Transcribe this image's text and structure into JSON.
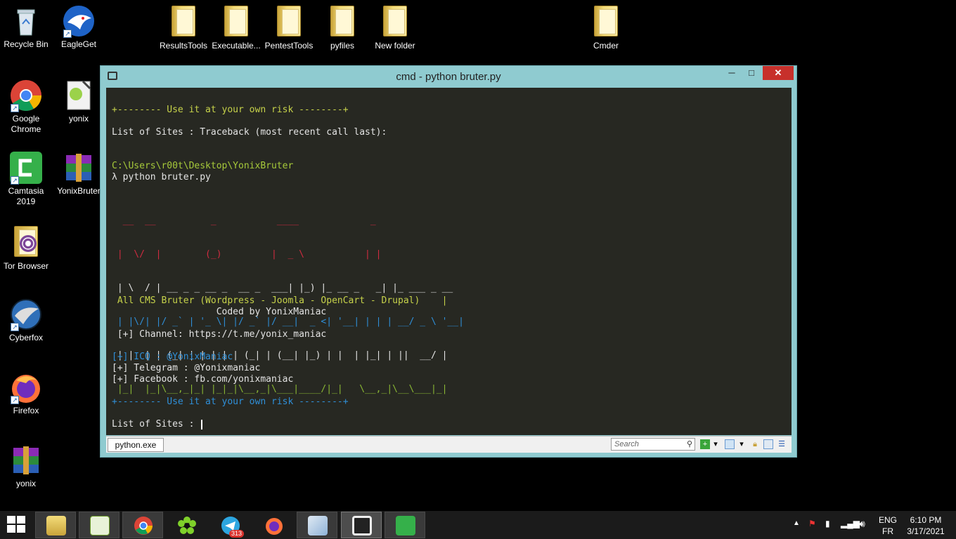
{
  "desktop": {
    "icons": [
      {
        "id": "recycle-bin",
        "label": "Recycle Bin"
      },
      {
        "id": "eagleget",
        "label": "EagleGet"
      },
      {
        "id": "resultstools",
        "label": "ResultsTools"
      },
      {
        "id": "executable",
        "label": "Executable..."
      },
      {
        "id": "pentesttools",
        "label": "PentestTools"
      },
      {
        "id": "pyfiles",
        "label": "pyfiles"
      },
      {
        "id": "new-folder",
        "label": "New folder"
      },
      {
        "id": "cmder",
        "label": "Cmder"
      },
      {
        "id": "google-chrome",
        "label": "Google Chrome"
      },
      {
        "id": "yonix",
        "label": "yonix"
      },
      {
        "id": "camtasia",
        "label": "Camtasia 2019"
      },
      {
        "id": "yonixbruter",
        "label": "YonixBruter"
      },
      {
        "id": "tor-browser",
        "label": "Tor Browser"
      },
      {
        "id": "cyberfox",
        "label": "Cyberfox"
      },
      {
        "id": "firefox",
        "label": "Firefox"
      },
      {
        "id": "yonix-archive",
        "label": "yonix"
      }
    ]
  },
  "window": {
    "title": "cmd - python  bruter.py",
    "min_label": "─",
    "max_label": "□",
    "close_label": "✕"
  },
  "console": {
    "line1": "+-------- Use it at your own risk --------+",
    "line2": "List of Sites : Traceback (most recent call last):",
    "path": "C:\\Users\\r00t\\Desktop\\YonixBruter",
    "command": "λ python bruter.py",
    "banner": [
      "  __  __          _           ____             _            ",
      " |  \\/  |        (_)         |  _ \\           | |           ",
      " | \\  / | __ _ _ __ _  __ _  ___| |_) |_ __ _   _| |_ ___ _ __ ",
      " | |\\/| |/ _` | '_ \\| |/ _` |/ __|  _ <| '__| | | | __/ _ \\ '__|",
      " | |  | | (_| | | | | | (_| | (__| |_) | |  | |_| | ||  __/ |   ",
      " |_|  |_|\\__,_|_| |_|_|\\__,_|\\___|____/|_|   \\__,_|\\__\\___|_|   "
    ],
    "cms_line": " All CMS Bruter (Wordpress - Joomla - OpenCart - Drupal)    |",
    "coded_line": "                   Coded by YonixManiac",
    "channel_line": " [+] Channel: https://t.me/yonix_maniac",
    "icq_line": "[+] ICQ : @YonixManiac",
    "telegram_line": "[+] Telegram : @Yonixmaniac",
    "facebook_line": "[+] Facebook : fb.com/yonixmaniac",
    "line_risk2": "+-------- Use it at your own risk --------+",
    "prompt": "List of Sites : "
  },
  "statusbar": {
    "tab_label": "python.exe",
    "search_placeholder": "Search"
  },
  "taskbar": {
    "items": [
      "file-explorer",
      "notepad-plus",
      "chrome",
      "icq",
      "telegram",
      "firefox",
      "wordpad",
      "cmder",
      "camtasia"
    ],
    "telegram_badge": "313",
    "lang_top": "ENG",
    "lang_bottom": "FR",
    "time": "6:10 PM",
    "date": "3/17/2021"
  },
  "colors": {
    "console_bg": "#272822",
    "window_frame": "#8fcbd0",
    "close_button": "#c7302b",
    "accent_yellow": "#c6d24a",
    "accent_blue": "#2f8fd8",
    "accent_red": "#d12b40",
    "taskbar_bg": "#1b1b1b"
  }
}
